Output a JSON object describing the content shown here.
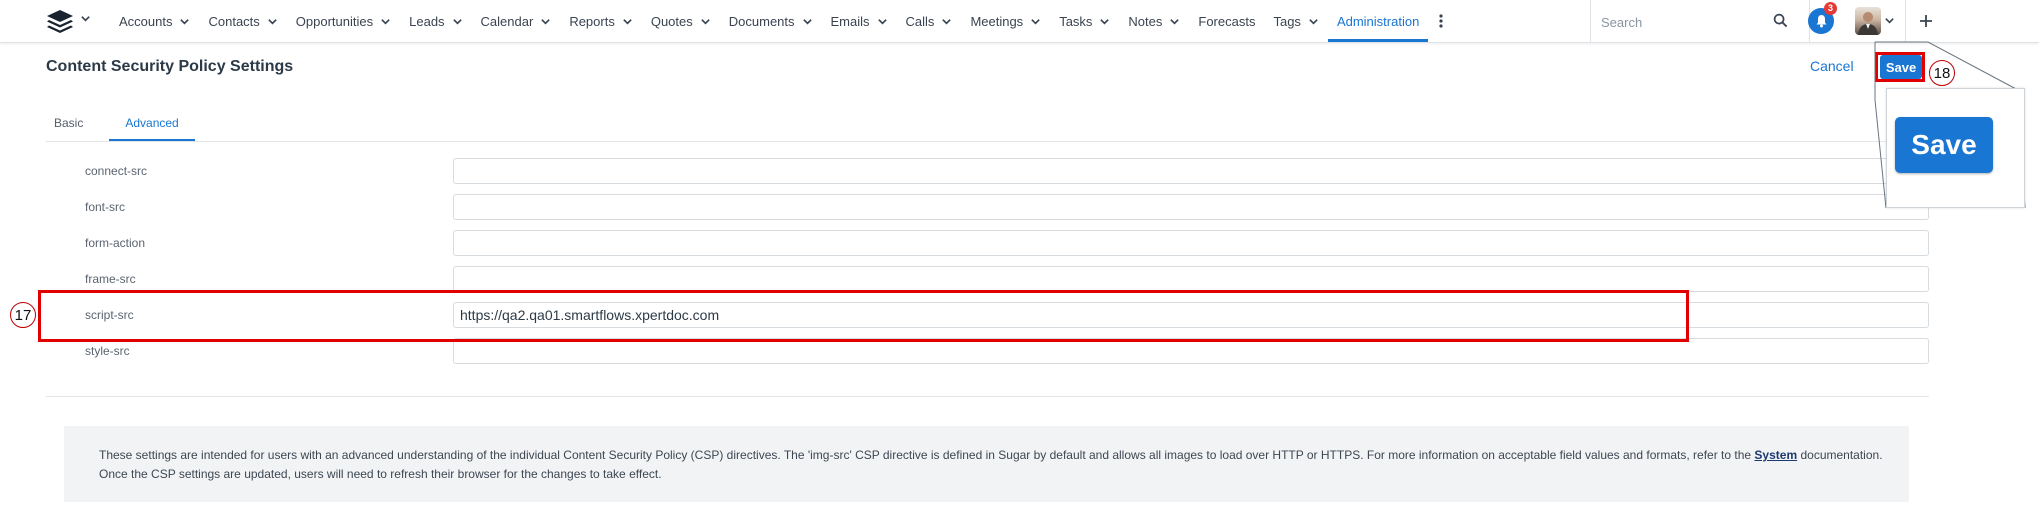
{
  "nav": {
    "items": [
      {
        "label": "Accounts",
        "has_menu": true
      },
      {
        "label": "Contacts",
        "has_menu": true
      },
      {
        "label": "Opportunities",
        "has_menu": true
      },
      {
        "label": "Leads",
        "has_menu": true
      },
      {
        "label": "Calendar",
        "has_menu": true
      },
      {
        "label": "Reports",
        "has_menu": true
      },
      {
        "label": "Quotes",
        "has_menu": true
      },
      {
        "label": "Documents",
        "has_menu": true
      },
      {
        "label": "Emails",
        "has_menu": true
      },
      {
        "label": "Calls",
        "has_menu": true
      },
      {
        "label": "Meetings",
        "has_menu": true
      },
      {
        "label": "Tasks",
        "has_menu": true
      },
      {
        "label": "Notes",
        "has_menu": true
      },
      {
        "label": "Forecasts",
        "has_menu": false
      },
      {
        "label": "Tags",
        "has_menu": true
      },
      {
        "label": "Administration",
        "has_menu": false,
        "active": true
      }
    ],
    "search_placeholder": "Search",
    "notification_count": "3",
    "accent_color": "#1976d2"
  },
  "header": {
    "title": "Content Security Policy Settings",
    "cancel_label": "Cancel",
    "save_label": "Save"
  },
  "tabs": [
    {
      "label": "Basic",
      "active": false
    },
    {
      "label": "Advanced",
      "active": true
    }
  ],
  "form": {
    "fields": [
      {
        "label": "connect-src",
        "value": ""
      },
      {
        "label": "font-src",
        "value": ""
      },
      {
        "label": "form-action",
        "value": ""
      },
      {
        "label": "frame-src",
        "value": ""
      },
      {
        "label": "script-src",
        "value": "https://qa2.qa01.smartflows.xpertdoc.com"
      },
      {
        "label": "style-src",
        "value": ""
      }
    ]
  },
  "info": {
    "text_before_link": "These settings are intended for users with an advanced understanding of the individual Content Security Policy (CSP) directives. The 'img-src' CSP directive is defined in Sugar by default and allows all images to load over HTTP or HTTPS. For more information on acceptable field values and formats, refer to the",
    "link_label": "System",
    "text_after_link": "documentation. Once the CSP settings are updated, users will need to refresh their browser for the changes to take effect."
  },
  "annotations": {
    "step_17": "17",
    "step_18": "18",
    "zoom_save_label": "Save",
    "highlight_color": "#e00000"
  }
}
